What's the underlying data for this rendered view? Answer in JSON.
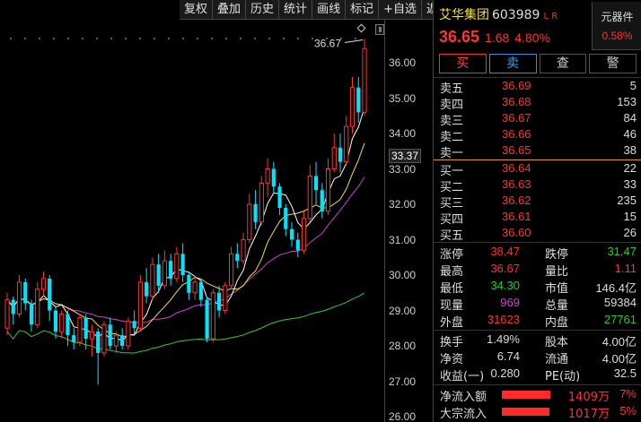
{
  "toolbar": {
    "items": [
      "复权",
      "叠加",
      "历史",
      "统计",
      "画线",
      "标记",
      "+自选",
      "返回"
    ]
  },
  "chart": {
    "peak_label": "36.67",
    "axis_ticks": [
      "36.00",
      "35.00",
      "34.00",
      "33.00",
      "32.00",
      "31.00",
      "30.00",
      "29.00",
      "28.00",
      "27.00",
      "26.00"
    ],
    "current_price_label": "33.37",
    "colors": {
      "up": "#ff3333",
      "down": "#00e5ff",
      "ma5": "#ffffff",
      "ma10": "#f0e040",
      "ma20": "#cc44cc",
      "ma60": "#33cc33"
    }
  },
  "chart_data": {
    "type": "candlestick",
    "ylim": [
      26.0,
      36.67
    ],
    "ma_lines": [
      "MA5",
      "MA10",
      "MA20",
      "MA60"
    ],
    "candles": [
      [
        28.5,
        29.3,
        28.3,
        29.5
      ],
      [
        29.3,
        28.9,
        28.6,
        29.4
      ],
      [
        28.9,
        29.8,
        28.8,
        30.0
      ],
      [
        29.8,
        29.2,
        29.0,
        29.9
      ],
      [
        29.2,
        28.6,
        28.4,
        29.3
      ],
      [
        28.6,
        29.6,
        28.5,
        29.8
      ],
      [
        29.6,
        29.9,
        29.4,
        30.1
      ],
      [
        29.9,
        29.0,
        28.7,
        30.0
      ],
      [
        29.0,
        28.4,
        28.2,
        29.1
      ],
      [
        28.4,
        28.9,
        28.2,
        29.0
      ],
      [
        28.9,
        28.3,
        28.0,
        29.0
      ],
      [
        28.3,
        28.1,
        27.9,
        28.5
      ],
      [
        28.1,
        28.8,
        28.0,
        28.9
      ],
      [
        28.8,
        28.2,
        27.9,
        28.9
      ],
      [
        28.2,
        28.4,
        27.7,
        28.6
      ],
      [
        28.4,
        27.8,
        26.9,
        28.5
      ],
      [
        27.8,
        28.6,
        27.7,
        28.7
      ],
      [
        28.6,
        28.0,
        27.9,
        28.8
      ],
      [
        28.0,
        28.3,
        27.8,
        28.4
      ],
      [
        28.3,
        28.0,
        27.9,
        28.5
      ],
      [
        28.0,
        28.7,
        27.9,
        28.8
      ],
      [
        28.7,
        28.5,
        28.3,
        29.0
      ],
      [
        28.5,
        29.8,
        28.4,
        30.0
      ],
      [
        29.8,
        29.4,
        29.2,
        30.2
      ],
      [
        29.4,
        30.3,
        29.3,
        30.5
      ],
      [
        30.3,
        29.7,
        29.5,
        30.6
      ],
      [
        29.7,
        30.4,
        29.6,
        30.7
      ],
      [
        30.4,
        29.9,
        29.7,
        30.6
      ],
      [
        29.9,
        30.6,
        29.8,
        30.8
      ],
      [
        30.6,
        30.0,
        29.8,
        30.9
      ],
      [
        30.0,
        29.5,
        29.3,
        30.1
      ],
      [
        29.5,
        29.8,
        29.3,
        30.0
      ],
      [
        29.8,
        29.3,
        29.1,
        29.9
      ],
      [
        29.3,
        28.2,
        28.1,
        29.4
      ],
      [
        28.2,
        29.5,
        28.1,
        29.6
      ],
      [
        29.5,
        29.0,
        28.8,
        29.7
      ],
      [
        29.0,
        29.7,
        28.9,
        29.8
      ],
      [
        29.7,
        30.6,
        29.6,
        30.8
      ],
      [
        30.6,
        30.4,
        30.2,
        30.9
      ],
      [
        30.4,
        31.0,
        30.3,
        31.2
      ],
      [
        31.0,
        32.0,
        30.9,
        32.3
      ],
      [
        32.0,
        31.5,
        31.3,
        32.4
      ],
      [
        31.5,
        32.6,
        31.4,
        32.8
      ],
      [
        32.6,
        33.0,
        32.2,
        33.3
      ],
      [
        33.0,
        32.5,
        32.3,
        33.2
      ],
      [
        32.5,
        31.9,
        31.7,
        32.6
      ],
      [
        31.9,
        31.3,
        31.1,
        32.0
      ],
      [
        31.3,
        31.0,
        30.8,
        31.5
      ],
      [
        31.0,
        30.7,
        30.5,
        31.2
      ],
      [
        30.7,
        31.6,
        30.6,
        31.8
      ],
      [
        31.6,
        32.8,
        31.5,
        33.1
      ],
      [
        32.8,
        32.4,
        32.0,
        33.2
      ],
      [
        32.4,
        31.8,
        31.6,
        32.6
      ],
      [
        31.8,
        33.0,
        31.7,
        33.3
      ],
      [
        33.0,
        33.6,
        32.9,
        34.0
      ],
      [
        33.6,
        33.2,
        32.9,
        34.0
      ],
      [
        33.2,
        34.2,
        33.1,
        34.5
      ],
      [
        34.2,
        35.3,
        34.0,
        35.6
      ],
      [
        35.3,
        34.6,
        34.3,
        35.6
      ],
      [
        34.6,
        36.4,
        34.5,
        36.67
      ]
    ],
    "last_close": 36.65
  },
  "stock": {
    "name": "艾华集团",
    "code": "603989",
    "tags": "L R",
    "price": "36.65",
    "change": "1.68",
    "change_pct": "4.80%",
    "sector_name": "元器件",
    "sector_pct": "0.58%"
  },
  "trade_buttons": {
    "buy": "买",
    "sell": "卖",
    "query": "查",
    "alert": "警"
  },
  "asks": [
    {
      "label": "卖五",
      "price": "36.69",
      "volume": "5"
    },
    {
      "label": "卖四",
      "price": "36.68",
      "volume": "153"
    },
    {
      "label": "卖三",
      "price": "36.67",
      "volume": "84"
    },
    {
      "label": "卖二",
      "price": "36.66",
      "volume": "46"
    },
    {
      "label": "卖一",
      "price": "36.65",
      "volume": "38"
    }
  ],
  "bids": [
    {
      "label": "买一",
      "price": "36.64",
      "volume": "22"
    },
    {
      "label": "买二",
      "price": "36.63",
      "volume": "33"
    },
    {
      "label": "买三",
      "price": "36.62",
      "volume": "235"
    },
    {
      "label": "买四",
      "price": "36.61",
      "volume": "15"
    },
    {
      "label": "买五",
      "price": "36.60",
      "volume": "26"
    }
  ],
  "stats": [
    {
      "l1": "涨停",
      "v1": "38.47",
      "c1": "red",
      "l2": "跌停",
      "v2": "31.47",
      "c2": "green"
    },
    {
      "l1": "最高",
      "v1": "36.67",
      "c1": "red",
      "l2": "量比",
      "v2": "1.11",
      "c2": "red"
    },
    {
      "l1": "最低",
      "v1": "34.30",
      "c1": "green",
      "l2": "市值",
      "v2": "146.4亿",
      "c2": "white"
    },
    {
      "l1": "现量",
      "v1": "969",
      "c1": "purple",
      "l2": "总量",
      "v2": "59384",
      "c2": "white"
    },
    {
      "l1": "外盘",
      "v1": "31623",
      "c1": "red",
      "l2": "内盘",
      "v2": "27761",
      "c2": "green"
    }
  ],
  "stats2": [
    {
      "l1": "换手",
      "v1": "1.49%",
      "c1": "white",
      "l2": "股本",
      "v2": "4.00亿",
      "c2": "white"
    },
    {
      "l1": "净资",
      "v1": "6.74",
      "c1": "white",
      "l2": "流通",
      "v2": "4.00亿",
      "c2": "white"
    },
    {
      "l1": "收益(一)",
      "v1": "0.280",
      "c1": "white",
      "l2": "PE(动)",
      "v2": "32.5",
      "c2": "white"
    }
  ],
  "flows": [
    {
      "label": "净流入额",
      "value": "1409万",
      "pct": "7%",
      "bar_fraction": 0.75
    },
    {
      "label": "大宗流入",
      "value": "1017万",
      "pct": "5%",
      "bar_fraction": 0.74
    }
  ]
}
